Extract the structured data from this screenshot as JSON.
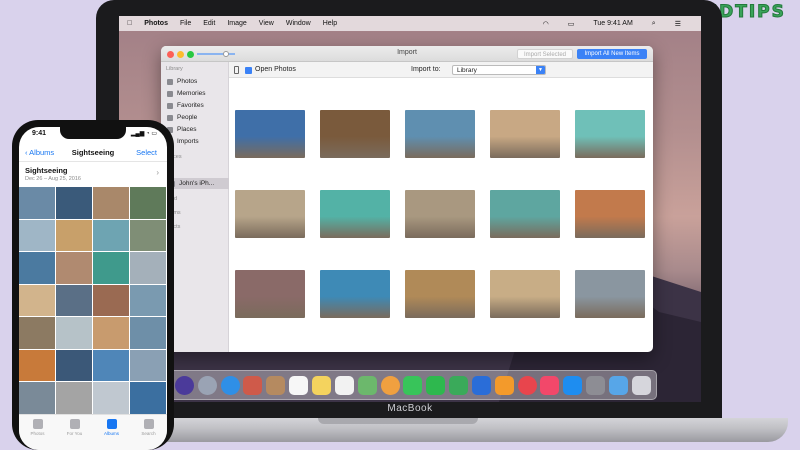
{
  "watermark": {
    "brand": "GETDROIDTIPS"
  },
  "laptop": {
    "label": "MacBook"
  },
  "menubar": {
    "app": "Photos",
    "items": [
      "File",
      "Edit",
      "Image",
      "View",
      "Window",
      "Help"
    ],
    "clock": "Tue 9:41 AM"
  },
  "window": {
    "title": "Import",
    "import_selected": "Import Selected",
    "import_all": "Import All New Items",
    "open_photos": "Open Photos",
    "import_to_label": "Import to:",
    "import_to_value": "Library"
  },
  "sidebar": {
    "library_header": "Library",
    "items": [
      "Photos",
      "Memories",
      "Favorites",
      "People",
      "Places",
      "Imports"
    ],
    "devices_header": "evices",
    "device": "John's iPh...",
    "shared_header": "ared",
    "albums_header": "lbums",
    "projects_header": "ojects"
  },
  "colors": {
    "accent": "#3b82f6",
    "ios_blue": "#1877f2",
    "watermark_green": "#3aa35a",
    "backdrop": "#d9d2ec"
  },
  "photos": [
    "#3f6fa8",
    "#7a5a3c",
    "#5f8fb0",
    "#c8a884",
    "#6fc0b8",
    "#b7a58a",
    "#53b2a6",
    "#a99880",
    "#5ea6a0",
    "#c27a4c",
    "#8a6a68",
    "#3e8ab6",
    "#b08a58",
    "#c8ad86",
    "#8a96a0"
  ],
  "phone": {
    "time": "9:41",
    "status": "▂▄▆ ◔ ▭",
    "back_label": "Albums",
    "title": "Sightseeing",
    "select_label": "Select",
    "album_title": "Sightseeing",
    "album_dates": "Dec 26 – Aug 25, 2016",
    "tabs": [
      {
        "label": "Photos",
        "active": false
      },
      {
        "label": "For You",
        "active": false
      },
      {
        "label": "Albums",
        "active": true
      },
      {
        "label": "Search",
        "active": false
      }
    ],
    "thumb_colors": [
      "#6a8aa6",
      "#3a5a7a",
      "#a9886a",
      "#5f7a5a",
      "#9fb6c6",
      "#c8a06a",
      "#6ea4b2",
      "#7f8e76",
      "#4b7aa0",
      "#b08a70",
      "#3f9a8c",
      "#a4b0ba",
      "#d2b48c",
      "#5a6f86",
      "#9a6a52",
      "#7a9ab0",
      "#8c7a62",
      "#b6c2c8",
      "#c89b6e",
      "#6e8fa8",
      "#c87a3a",
      "#3b5878",
      "#4f86b8",
      "#8aa0b4",
      "#7a8a98",
      "#a4a4a4",
      "#c0c8d0",
      "#3b6fa0"
    ]
  },
  "dock": {
    "icons": [
      {
        "name": "siri-icon",
        "color": "#4b3a9a",
        "round": true
      },
      {
        "name": "launchpad-icon",
        "color": "#9aa3b4",
        "round": true
      },
      {
        "name": "safari-icon",
        "color": "#2f8fe6",
        "round": true
      },
      {
        "name": "photo-booth-icon",
        "color": "#cf5a4a",
        "round": false
      },
      {
        "name": "contacts-icon",
        "color": "#b58a60",
        "round": false
      },
      {
        "name": "calendar-icon",
        "color": "#f7f7f7",
        "round": false
      },
      {
        "name": "notes-icon",
        "color": "#f4d35e",
        "round": false
      },
      {
        "name": "reminders-icon",
        "color": "#f2f2f2",
        "round": false
      },
      {
        "name": "maps-icon",
        "color": "#6cb86c",
        "round": false
      },
      {
        "name": "photos-icon",
        "color": "#f0a040",
        "round": true
      },
      {
        "name": "messages-icon",
        "color": "#38c45a",
        "round": false
      },
      {
        "name": "facetime-icon",
        "color": "#2eb84e",
        "round": false
      },
      {
        "name": "numbers-icon",
        "color": "#3aaa5a",
        "round": false
      },
      {
        "name": "keynote-icon",
        "color": "#2a6dd8",
        "round": false
      },
      {
        "name": "pages-icon",
        "color": "#f39a2b",
        "round": false
      },
      {
        "name": "news-icon",
        "color": "#e8454d",
        "round": true
      },
      {
        "name": "music-icon",
        "color": "#f2486a",
        "round": false
      },
      {
        "name": "app-store-icon",
        "color": "#1e8df0",
        "round": false
      },
      {
        "name": "system-preferences-icon",
        "color": "#8d8d94",
        "round": false
      },
      {
        "name": "downloads-folder-icon",
        "color": "#57a6e8",
        "round": false
      },
      {
        "name": "trash-icon",
        "color": "#d6d6dc",
        "round": false
      }
    ]
  }
}
